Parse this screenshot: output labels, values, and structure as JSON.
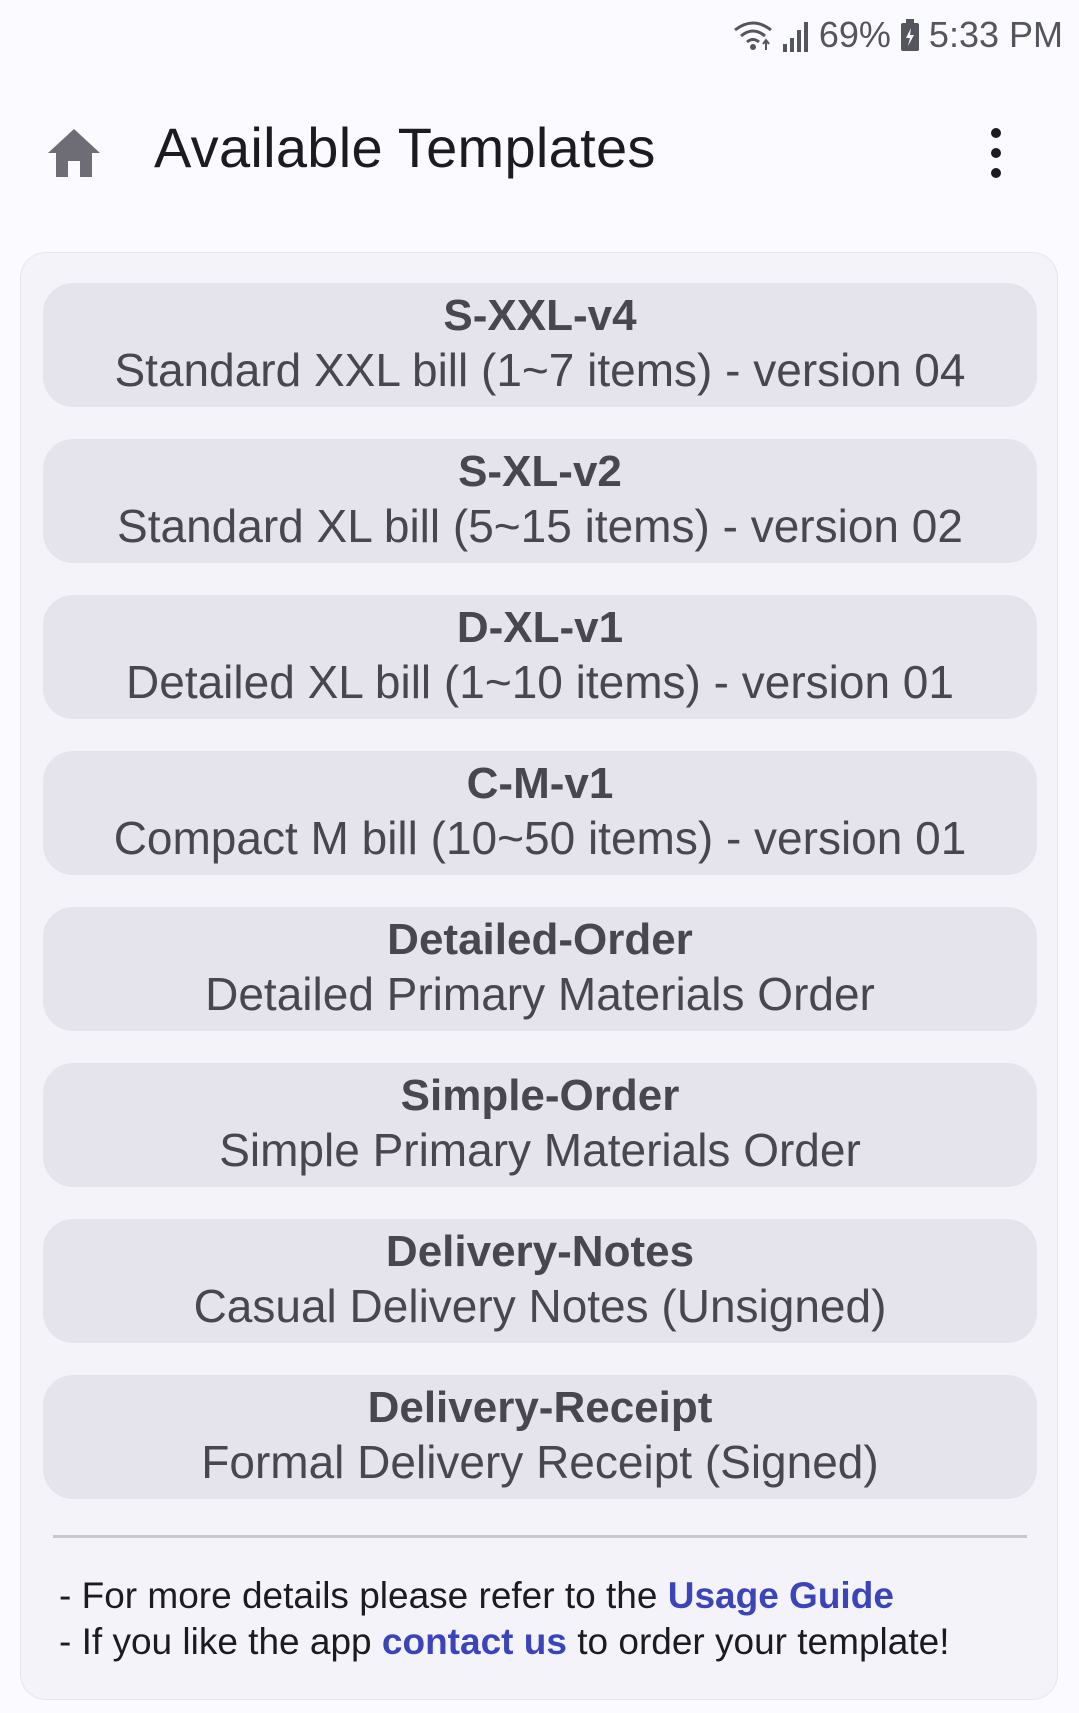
{
  "status_bar": {
    "battery": "69%",
    "time": "5:33 PM"
  },
  "app_bar": {
    "title": "Available Templates",
    "home_icon": "home-icon",
    "menu_icon": "more-vert-icon"
  },
  "templates": [
    {
      "code": "S-XXL-v4",
      "description": "Standard XXL bill (1~7 items) - version 04"
    },
    {
      "code": "S-XL-v2",
      "description": "Standard XL bill (5~15 items) - version 02"
    },
    {
      "code": "D-XL-v1",
      "description": "Detailed XL bill (1~10 items) - version 01"
    },
    {
      "code": "C-M-v1",
      "description": "Compact M bill (10~50 items) - version 01"
    },
    {
      "code": "Detailed-Order",
      "description": "Detailed Primary Materials Order"
    },
    {
      "code": "Simple-Order",
      "description": "Simple Primary Materials Order"
    },
    {
      "code": "Delivery-Notes",
      "description": "Casual Delivery Notes (Unsigned)"
    },
    {
      "code": "Delivery-Receipt",
      "description": "Formal Delivery Receipt (Signed)"
    }
  ],
  "footer": {
    "line1_prefix": "- For more details please refer to the ",
    "line1_link": "Usage Guide",
    "line2_prefix": "- If you like the app ",
    "line2_link": "contact us",
    "line2_suffix": " to order your template!"
  },
  "colors": {
    "link": "#3b45b8",
    "button_bg": "#e5e4ec",
    "card_bg": "#f4f3fa"
  }
}
